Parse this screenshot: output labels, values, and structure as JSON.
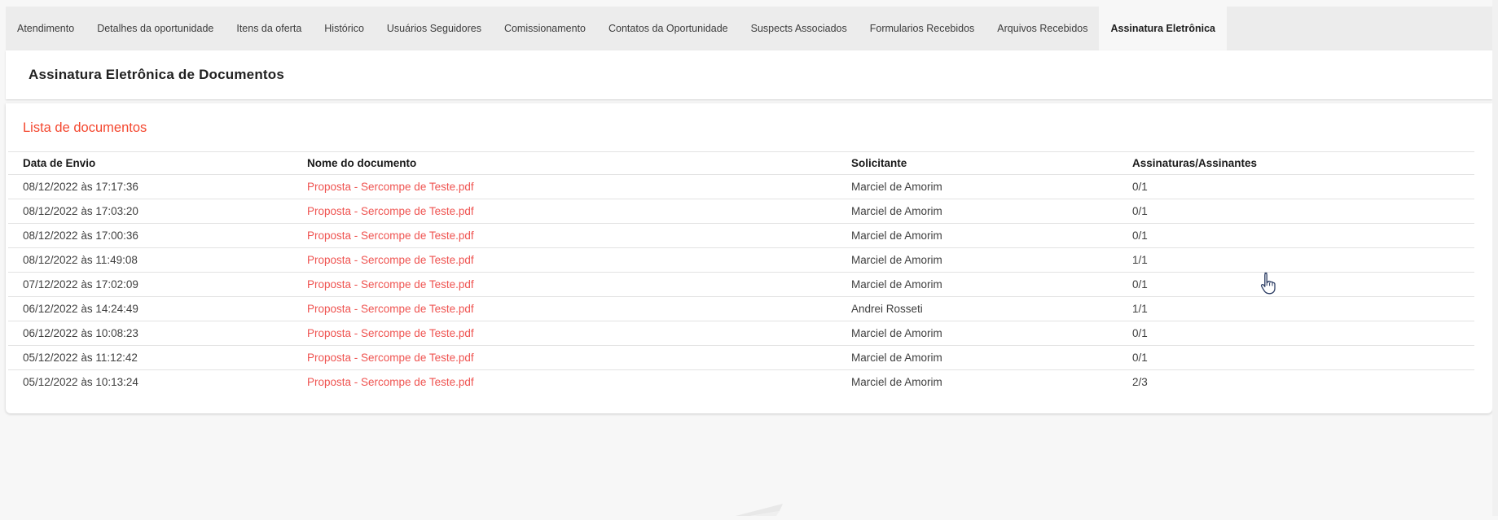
{
  "tabs": [
    {
      "label": "Atendimento",
      "active": false
    },
    {
      "label": "Detalhes da oportunidade",
      "active": false
    },
    {
      "label": "Itens da oferta",
      "active": false
    },
    {
      "label": "Histórico",
      "active": false
    },
    {
      "label": "Usuários Seguidores",
      "active": false
    },
    {
      "label": "Comissionamento",
      "active": false
    },
    {
      "label": "Contatos da Oportunidade",
      "active": false
    },
    {
      "label": "Suspects Associados",
      "active": false
    },
    {
      "label": "Formularios Recebidos",
      "active": false
    },
    {
      "label": "Arquivos Recebidos",
      "active": false
    },
    {
      "label": "Assinatura Eletrônica",
      "active": true
    }
  ],
  "header": {
    "title": "Assinatura Eletrônica de Documentos"
  },
  "section": {
    "title": "Lista de documentos"
  },
  "table": {
    "columns": [
      "Data de Envio",
      "Nome do documento",
      "Solicitante",
      "Assinaturas/Assinantes"
    ],
    "rows": [
      {
        "date": "08/12/2022 às 17:17:36",
        "name": "Proposta - Sercompe de Teste.pdf",
        "requester": "Marciel de Amorim",
        "signatures": "0/1"
      },
      {
        "date": "08/12/2022 às 17:03:20",
        "name": "Proposta - Sercompe de Teste.pdf",
        "requester": "Marciel de Amorim",
        "signatures": "0/1"
      },
      {
        "date": "08/12/2022 às 17:00:36",
        "name": "Proposta - Sercompe de Teste.pdf",
        "requester": "Marciel de Amorim",
        "signatures": "0/1"
      },
      {
        "date": "08/12/2022 às 11:49:08",
        "name": "Proposta - Sercompe de Teste.pdf",
        "requester": "Marciel de Amorim",
        "signatures": "1/1"
      },
      {
        "date": "07/12/2022 às 17:02:09",
        "name": "Proposta - Sercompe de Teste.pdf",
        "requester": "Marciel de Amorim",
        "signatures": "0/1"
      },
      {
        "date": "06/12/2022 às 14:24:49",
        "name": "Proposta - Sercompe de Teste.pdf",
        "requester": "Andrei Rosseti",
        "signatures": "1/1"
      },
      {
        "date": "06/12/2022 às 10:08:23",
        "name": "Proposta - Sercompe de Teste.pdf",
        "requester": "Marciel de Amorim",
        "signatures": "0/1"
      },
      {
        "date": "05/12/2022 às 11:12:42",
        "name": "Proposta - Sercompe de Teste.pdf",
        "requester": "Marciel de Amorim",
        "signatures": "0/1"
      },
      {
        "date": "05/12/2022 às 10:13:24",
        "name": "Proposta - Sercompe de Teste.pdf",
        "requester": "Marciel de Amorim",
        "signatures": "2/3"
      }
    ]
  },
  "colors": {
    "section_title": "#f4472f",
    "document_link": "#ef5350",
    "tabbar_bg": "#ececec",
    "active_tab_bg": "#f7f7f7",
    "card_bg": "#ffffff"
  }
}
